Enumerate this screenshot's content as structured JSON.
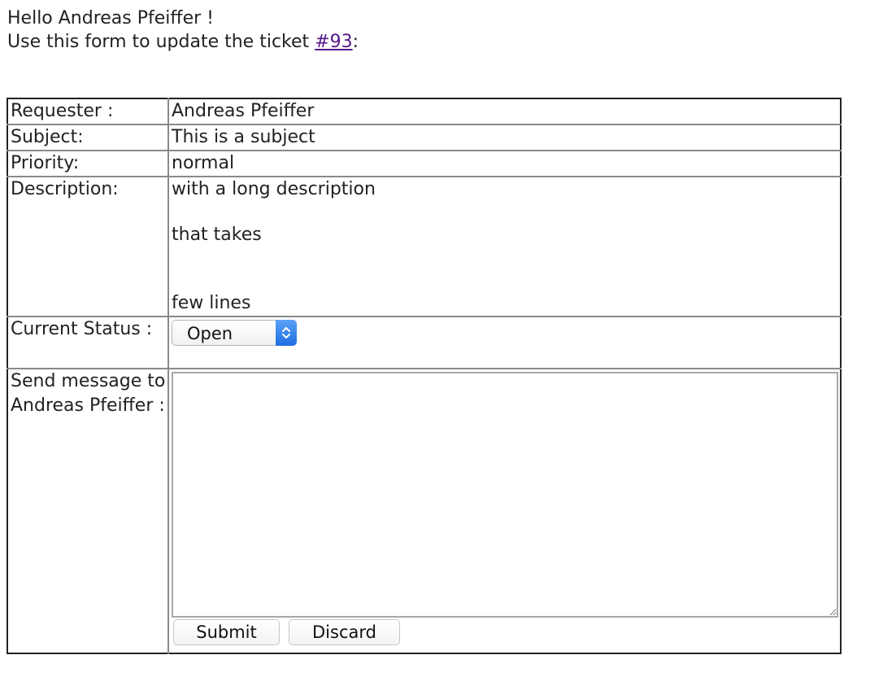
{
  "greeting": {
    "line1": "Hello Andreas Pfeiffer !",
    "line2_prefix": "Use this form to update the ticket ",
    "ticket_link": "#93",
    "line2_suffix": ":"
  },
  "ticket": {
    "requester_label": "Requester :",
    "requester_value": "Andreas Pfeiffer",
    "subject_label": "Subject:",
    "subject_value": "This is a subject",
    "priority_label": "Priority:",
    "priority_value": "normal",
    "description_label": "Description:",
    "description_lines": [
      "with a long description",
      "that takes",
      "few lines"
    ],
    "status_label": "Current Status :",
    "status_value": "Open",
    "message_label_line1": "Send message to",
    "message_label_line2": "Andreas Pfeiffer :",
    "message_value": ""
  },
  "buttons": {
    "submit": "Submit",
    "discard": "Discard"
  },
  "colors": {
    "link": "#551a8b",
    "select_accent": "#1f6fe3"
  },
  "icons": {
    "select_arrows": "up-down-chevron-icon",
    "resize_handle": "resize-grip-icon"
  }
}
